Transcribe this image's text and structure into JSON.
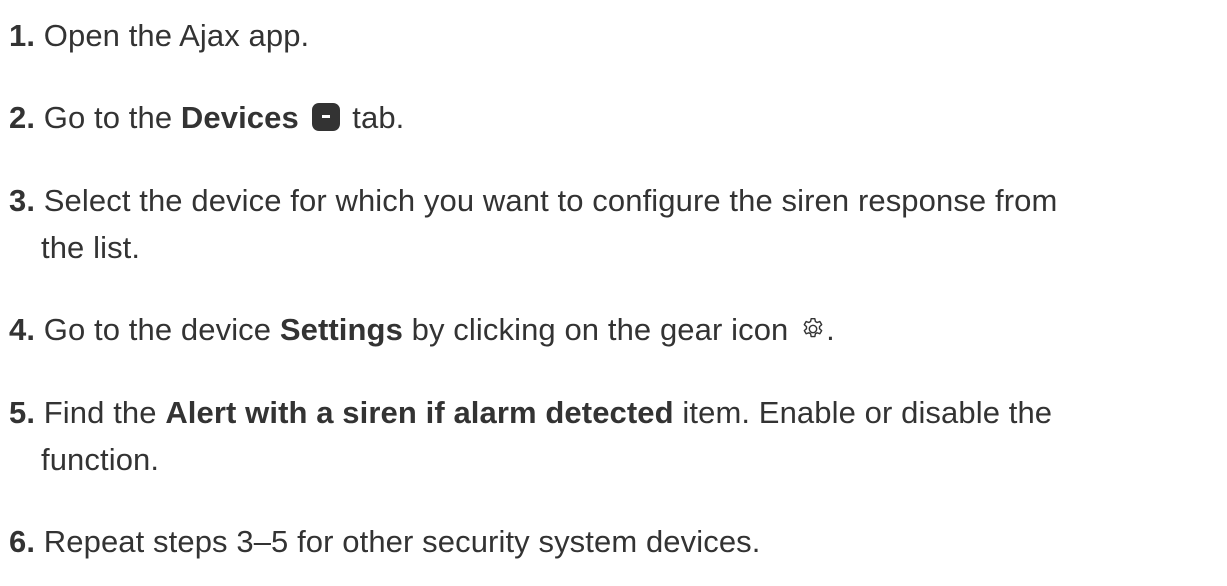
{
  "steps": [
    {
      "num": "1.",
      "pre": " Open the Ajax app."
    },
    {
      "num": "2.",
      "pre": " Go to the ",
      "bold": "Devices",
      "post": " tab.",
      "icon": "devices-icon"
    },
    {
      "num": "3.",
      "pre": " Select the device for which you want to configure the siren response from",
      "cont": "the list."
    },
    {
      "num": "4.",
      "pre": " Go to the device ",
      "bold": "Settings",
      "post": " by clicking on the gear icon ",
      "end": ".",
      "icon": "gear-icon"
    },
    {
      "num": "5.",
      "pre": " Find the ",
      "bold": "Alert with a siren if alarm detected",
      "post": " item. Enable or disable the",
      "cont": "function."
    },
    {
      "num": "6.",
      "pre": " Repeat steps 3–5 for other security system devices."
    }
  ],
  "colors": {
    "text": "#333333",
    "background": "#ffffff"
  }
}
